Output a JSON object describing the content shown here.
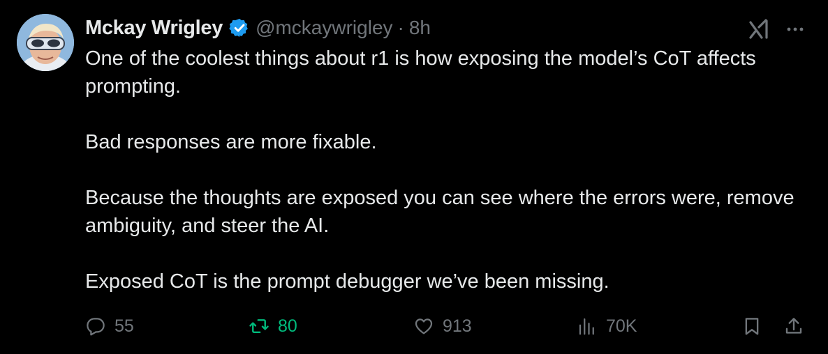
{
  "author": {
    "name": "Mckay Wrigley",
    "handle": "@mckaywrigley",
    "separator": "·",
    "time": "8h",
    "verified": true
  },
  "post": {
    "paragraphs": [
      "One of the coolest things about r1 is how exposing the model’s CoT affects prompting.",
      "Bad responses are more fixable.",
      "Because the thoughts are exposed you can see where the errors were, remove ambiguity, and steer the AI.",
      "Exposed CoT is the prompt debugger we’ve been missing."
    ]
  },
  "stats": {
    "replies": "55",
    "reposts": "80",
    "likes": "913",
    "views": "70K"
  },
  "icons": {
    "verified": "verified-badge-icon",
    "grok": "grok-icon",
    "more": "more-icon",
    "reply": "reply-icon",
    "repost": "repost-icon",
    "like": "heart-icon",
    "views": "views-icon",
    "bookmark": "bookmark-icon",
    "share": "share-icon"
  },
  "colors": {
    "background": "#000000",
    "text": "#e7e9ea",
    "muted": "#71767b",
    "verified": "#1d9bf0",
    "repost_active": "#00ba7c"
  }
}
